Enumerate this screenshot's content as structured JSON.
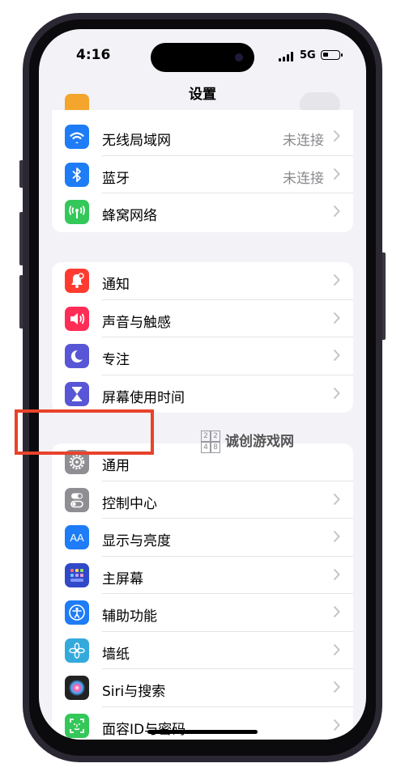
{
  "status_bar": {
    "time": "4:16",
    "network": "5G"
  },
  "nav": {
    "title": "设置"
  },
  "groups": [
    {
      "rows": [
        {
          "label": "无线局域网",
          "value": "未连接",
          "icon": "wifi-icon",
          "color": "#1e7cf6"
        },
        {
          "label": "蓝牙",
          "value": "未连接",
          "icon": "bluetooth-icon",
          "color": "#1e7cf6"
        },
        {
          "label": "蜂窝网络",
          "value": "",
          "icon": "cellular-icon",
          "color": "#34c759"
        }
      ]
    },
    {
      "rows": [
        {
          "label": "通知",
          "icon": "notification-bell-icon",
          "color": "#ff3b30"
        },
        {
          "label": "声音与触感",
          "icon": "speaker-icon",
          "color": "#ff2d55"
        },
        {
          "label": "专注",
          "icon": "moon-icon",
          "color": "#5856d6"
        },
        {
          "label": "屏幕使用时间",
          "icon": "hourglass-icon",
          "color": "#5856d6"
        }
      ]
    },
    {
      "rows": [
        {
          "label": "通用",
          "icon": "gear-icon",
          "color": "#8e8e93"
        },
        {
          "label": "控制中心",
          "icon": "control-center-toggle-icon",
          "color": "#8e8e93"
        },
        {
          "label": "显示与亮度",
          "icon": "aa-text-icon",
          "color": "#1e7cf6"
        },
        {
          "label": "主屏幕",
          "icon": "home-screen-grid-icon",
          "color": "#2f49c8"
        },
        {
          "label": "辅助功能",
          "icon": "accessibility-icon",
          "color": "#1e7cf6"
        },
        {
          "label": "墙纸",
          "icon": "flower-icon",
          "color": "#34aadc"
        },
        {
          "label": "Siri与搜索",
          "icon": "siri-orb-icon",
          "color": "#222222"
        },
        {
          "label": "面容ID与密码",
          "icon": "face-id-icon",
          "color": "#34c759"
        }
      ]
    }
  ],
  "watermark": {
    "text": "诚创游戏网",
    "logo_chars": [
      "2",
      "2",
      "4",
      "8"
    ]
  },
  "highlight_color": "#e8432b"
}
